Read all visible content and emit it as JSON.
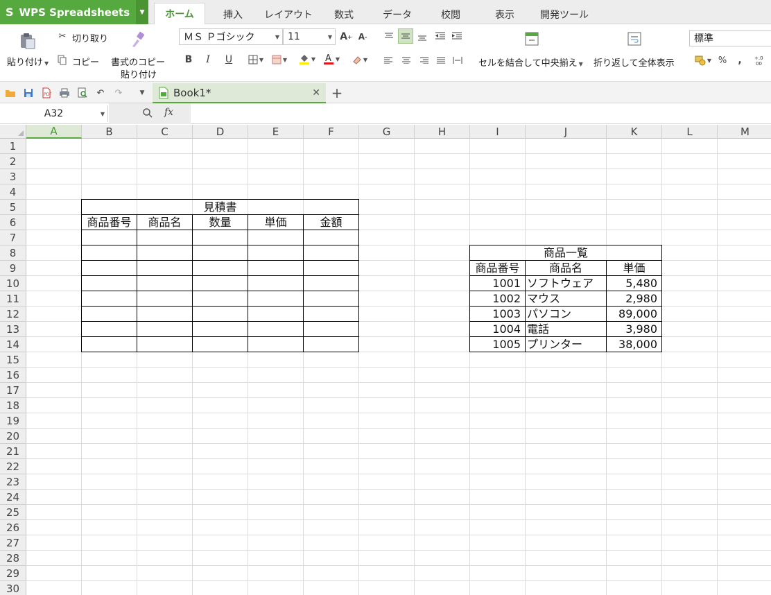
{
  "app": {
    "name": "WPS Spreadsheets"
  },
  "ribbon_tabs": [
    "ホーム",
    "挿入",
    "レイアウト",
    "数式",
    "データ",
    "校閲",
    "表示",
    "開発ツール"
  ],
  "ribbon": {
    "paste": "貼り付け",
    "cut": "切り取り",
    "copy": "コピー",
    "format_painter_1": "書式のコピー",
    "format_painter_2": "貼り付け",
    "font_name": "ＭＳ Ｐゴシック",
    "font_size": "11",
    "bold": "B",
    "italic": "I",
    "underline": "U",
    "merge_center": "セルを結合して中央揃え",
    "wrap_text": "折り返して全体表示",
    "number_format": "標準",
    "percent": "%",
    "comma": ","
  },
  "document_tab": {
    "title": "Book1*"
  },
  "formula_bar": {
    "name_box": "A32",
    "fx": "fx",
    "value": ""
  },
  "columns": [
    "A",
    "B",
    "C",
    "D",
    "E",
    "F",
    "G",
    "H",
    "I",
    "J",
    "K",
    "L",
    "M"
  ],
  "selected_column": "A",
  "rows": [
    1,
    2,
    3,
    4,
    5,
    6,
    7,
    8,
    9,
    10,
    11,
    12,
    13,
    14,
    15,
    16,
    17,
    18,
    19,
    20,
    21,
    22,
    23,
    24,
    25,
    26,
    27,
    28,
    29,
    30
  ],
  "estimate": {
    "title": "見積書",
    "headers": [
      "商品番号",
      "商品名",
      "数量",
      "単価",
      "金額"
    ]
  },
  "products": {
    "title": "商品一覧",
    "headers": [
      "商品番号",
      "商品名",
      "単価"
    ],
    "items": [
      {
        "id": "1001",
        "name": "ソフトウェア",
        "price": "5,480"
      },
      {
        "id": "1002",
        "name": "マウス",
        "price": "2,980"
      },
      {
        "id": "1003",
        "name": "パソコン",
        "price": "89,000"
      },
      {
        "id": "1004",
        "name": "電話",
        "price": "3,980"
      },
      {
        "id": "1005",
        "name": "プリンター",
        "price": "38,000"
      }
    ]
  },
  "colors": {
    "accent": "#56a93e",
    "accent_dark": "#4a9434",
    "tab_selected": "#dfe9d8"
  }
}
